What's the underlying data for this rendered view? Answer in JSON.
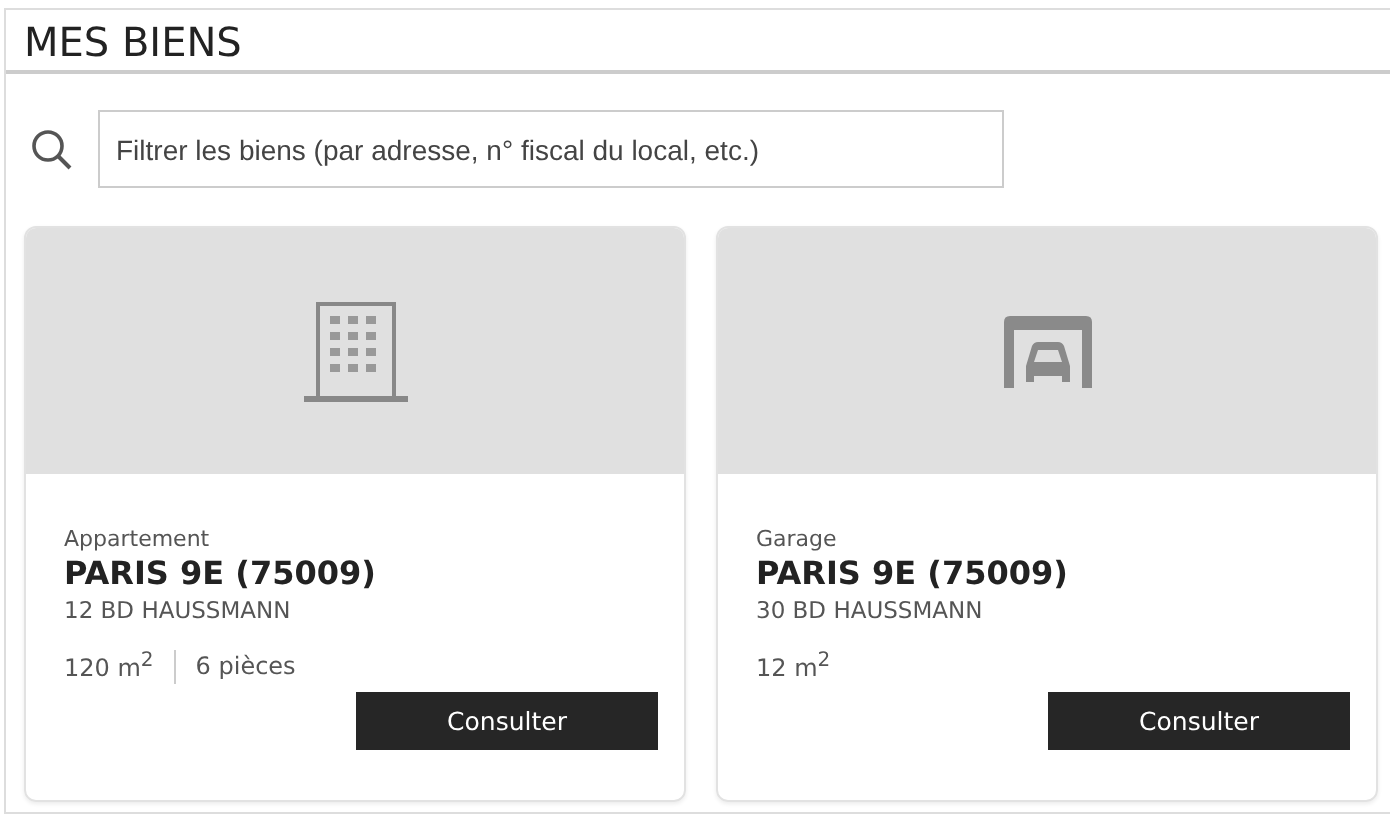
{
  "title": "MES BIENS",
  "search": {
    "placeholder": "Filtrer les biens (par adresse, n° fiscal du local, etc.)"
  },
  "properties": [
    {
      "kind": "building",
      "type": "Appartement",
      "city": "PARIS 9E (75009)",
      "address": "12 BD HAUSSMANN",
      "details": [
        "120 m$^{2}$",
        "6 pièces"
      ],
      "button": "Consulter"
    },
    {
      "kind": "garage",
      "type": "Garage",
      "city": "PARIS 9E (75009)",
      "address": "30 BD HAUSSMANN",
      "details": [
        "12 m$^{2}$"
      ],
      "button": "Consulter"
    }
  ]
}
